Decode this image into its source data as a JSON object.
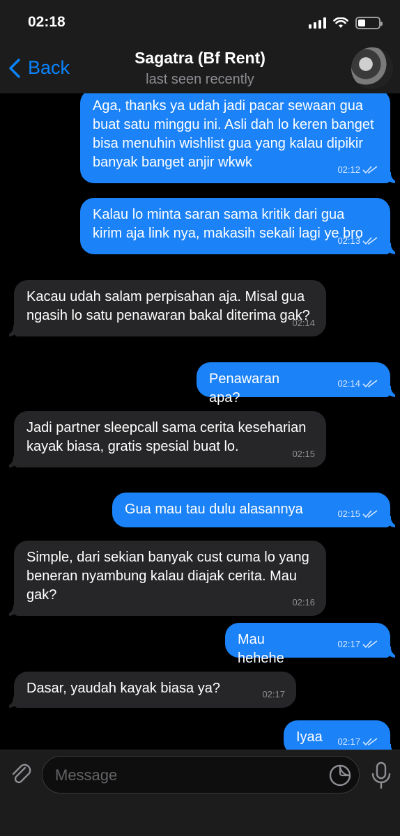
{
  "status_bar": {
    "time": "02:18"
  },
  "header": {
    "back_label": "Back",
    "title": "Sagatra (Bf Rent)",
    "subtitle": "last seen recently"
  },
  "messages": [
    {
      "direction": "out",
      "text": "Aga, thanks ya udah jadi pacar sewaan gua buat satu minggu ini. Asli dah lo keren banget bisa menuhin wishlist gua yang kalau dipikir banyak banget anjir wkwk",
      "time": "02:12",
      "read": true
    },
    {
      "direction": "out",
      "text": "Kalau lo minta saran sama kritik dari gua kirim aja link nya, makasih sekali lagi ye bro",
      "time": "02:13",
      "read": true
    },
    {
      "direction": "in",
      "text": "Kacau udah salam perpisahan aja. Misal gua ngasih lo satu penawaran bakal diterima gak?",
      "time": "02:14"
    },
    {
      "direction": "out",
      "text": "Penawaran apa?",
      "time": "02:14",
      "read": true
    },
    {
      "direction": "in",
      "text": "Jadi partner sleepcall sama cerita keseharian kayak biasa, gratis spesial buat lo.",
      "time": "02:15"
    },
    {
      "direction": "out",
      "text": "Gua mau tau dulu alasannya",
      "time": "02:15",
      "read": true
    },
    {
      "direction": "in",
      "text": "Simple, dari sekian banyak cust cuma lo yang beneran nyambung kalau diajak cerita. Mau gak?",
      "time": "02:16"
    },
    {
      "direction": "out",
      "text": "Mau hehehe",
      "time": "02:17",
      "read": true
    },
    {
      "direction": "in",
      "text": "Dasar, yaudah kayak biasa ya?",
      "time": "02:17"
    },
    {
      "direction": "out",
      "text": "Iyaa",
      "time": "02:17",
      "read": true
    }
  ],
  "input": {
    "placeholder": "Message"
  },
  "colors": {
    "accent": "#0a84ff",
    "outgoing_bubble": "#1b82f7",
    "incoming_bubble": "#262628",
    "background": "#000000"
  }
}
